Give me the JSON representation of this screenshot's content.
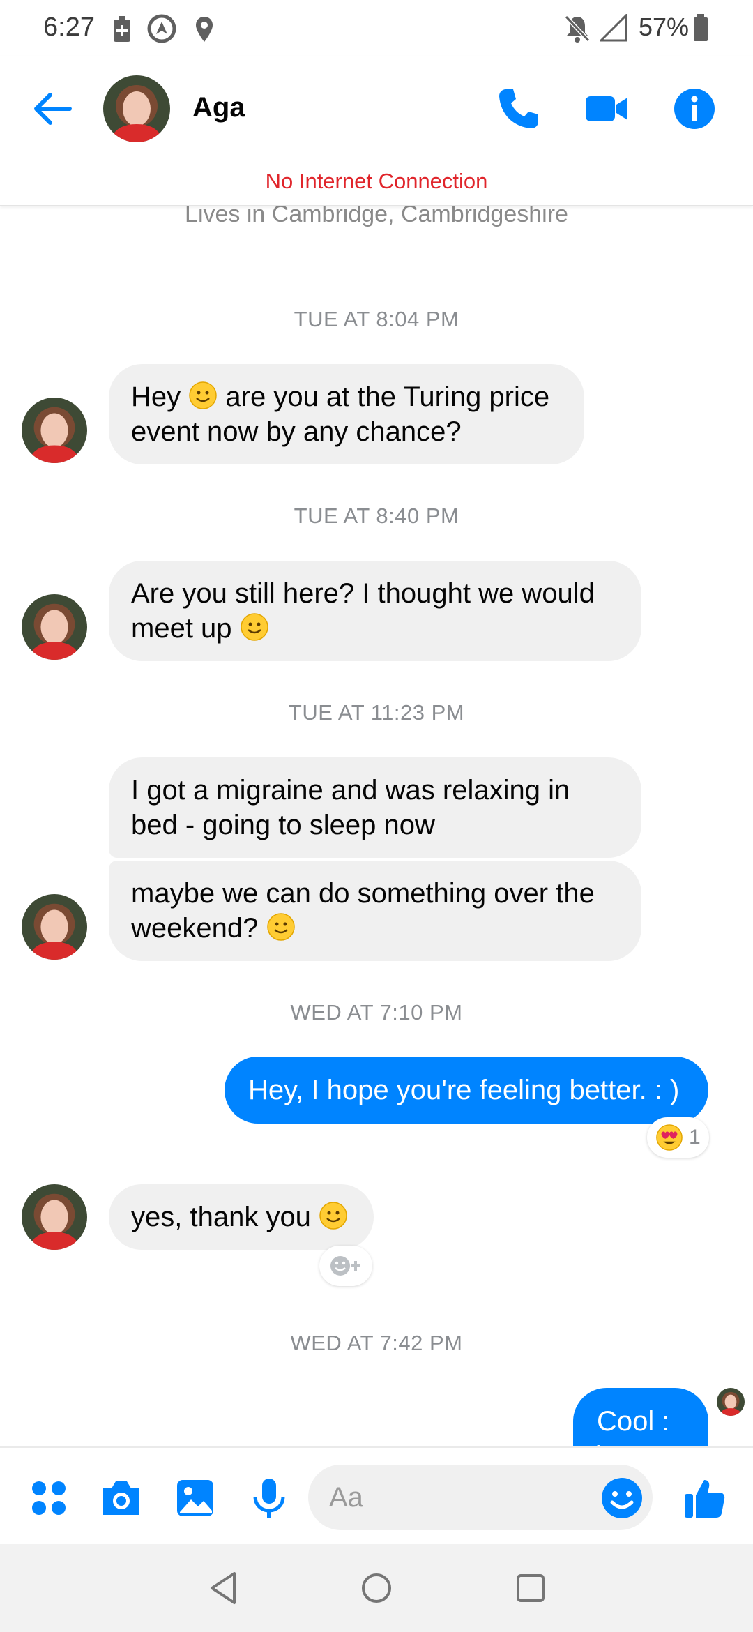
{
  "status_bar": {
    "time": "6:27",
    "battery_percent": "57%",
    "icons": [
      "battery-saver-icon",
      "location-alt-icon",
      "location-pin-icon",
      "notifications-off-icon",
      "signal-icon",
      "battery-icon"
    ]
  },
  "header": {
    "contact_name": "Aga",
    "banner": "No Internet Connection",
    "accent_color": "#0084ff",
    "banner_color": "#e0252b"
  },
  "conversation": {
    "profile_subline": "Lives in Cambridge, Cambridgeshire",
    "timestamps": [
      "TUE AT 8:04 PM",
      "TUE AT 8:40 PM",
      "TUE AT 11:23 PM",
      "WED AT 7:10 PM",
      "WED AT 7:42 PM"
    ],
    "messages": [
      {
        "from": "Aga",
        "line1": "Hey",
        "line1b": "are you at the Turing price",
        "line2": "event now by any chance?"
      },
      {
        "from": "Aga",
        "line1": "Are you still here? I thought we would",
        "line2": "meet up"
      },
      {
        "from": "Aga",
        "line1": "I got a migraine and was relaxing in",
        "line2": "bed - going to sleep now"
      },
      {
        "from": "Aga",
        "line1": "maybe we can do something over the",
        "line2": "weekend?"
      },
      {
        "from": "me",
        "text": "Hey, I hope you're feeling better. : )",
        "reaction_count": "1"
      },
      {
        "from": "Aga",
        "text": "yes, thank you"
      },
      {
        "from": "me",
        "text": "Cool : )"
      }
    ]
  },
  "composer": {
    "placeholder": "Aa"
  }
}
